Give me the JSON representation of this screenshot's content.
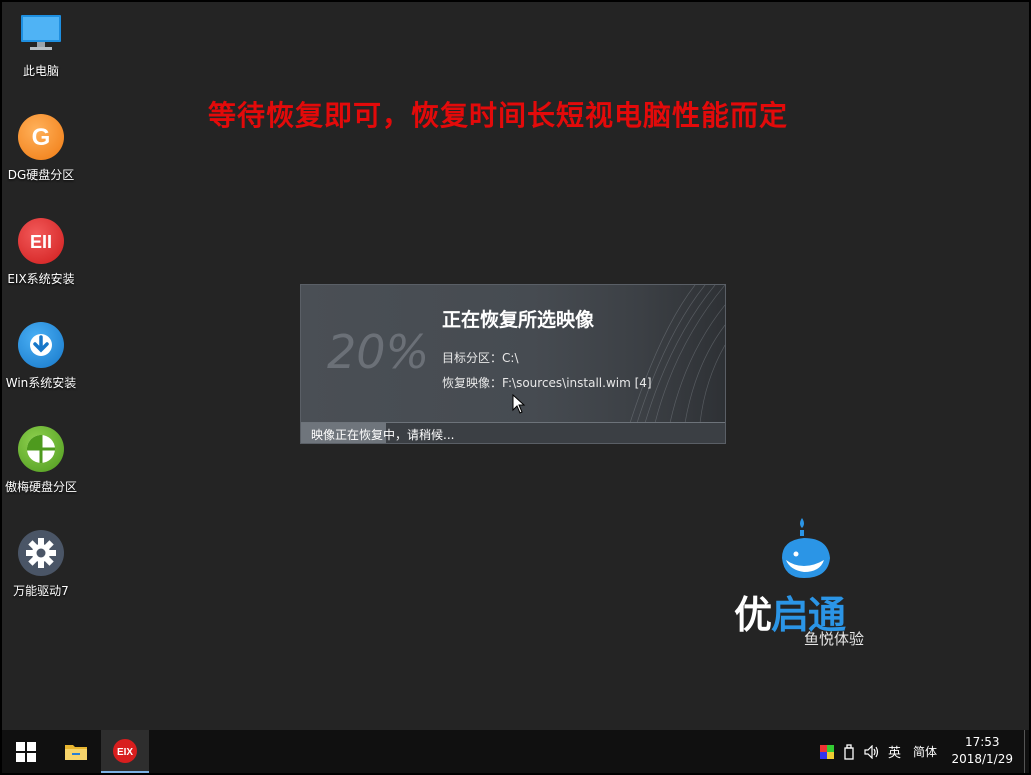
{
  "desktop": {
    "icons": [
      {
        "label": "此电脑",
        "icon": "computer-icon"
      },
      {
        "label": "DG硬盘分区",
        "icon": "dg-partition-icon"
      },
      {
        "label": "EIX系统安装",
        "icon": "eix-install-icon"
      },
      {
        "label": "Win系统安装",
        "icon": "win-install-icon"
      },
      {
        "label": "傲梅硬盘分区",
        "icon": "aomei-partition-icon"
      },
      {
        "label": "万能驱动7",
        "icon": "driver-gear-icon"
      }
    ],
    "instruction": "等待恢复即可，恢复时间长短视电脑性能而定"
  },
  "dialog": {
    "title": "正在恢复所选映像",
    "percent_text": "20%",
    "target_label": "目标分区：",
    "target_value": "C:\\",
    "image_label": "恢复映像：",
    "image_value": "F:\\sources\\install.wim [4]",
    "progress_text": "映像正在恢复中，请稍候...",
    "progress_fraction": 0.2
  },
  "brand": {
    "name_part1": "优",
    "name_part2": "启通",
    "subtitle": "鱼悦体验",
    "accent_color": "#2b95e6"
  },
  "taskbar": {
    "apps": [
      {
        "name": "start-button",
        "icon": "windows-logo-icon"
      },
      {
        "name": "file-explorer",
        "icon": "folder-icon"
      },
      {
        "name": "eix-app",
        "icon": "eix-icon",
        "active": true
      }
    ],
    "tray": {
      "ime_lang": "英",
      "ime_mode": "简体"
    },
    "clock": {
      "time": "17:53",
      "date": "2018/1/29"
    }
  },
  "colors": {
    "desktop_bg": "#242424",
    "instruction_red": "#e30a0a",
    "taskbar_bg": "#101010"
  }
}
